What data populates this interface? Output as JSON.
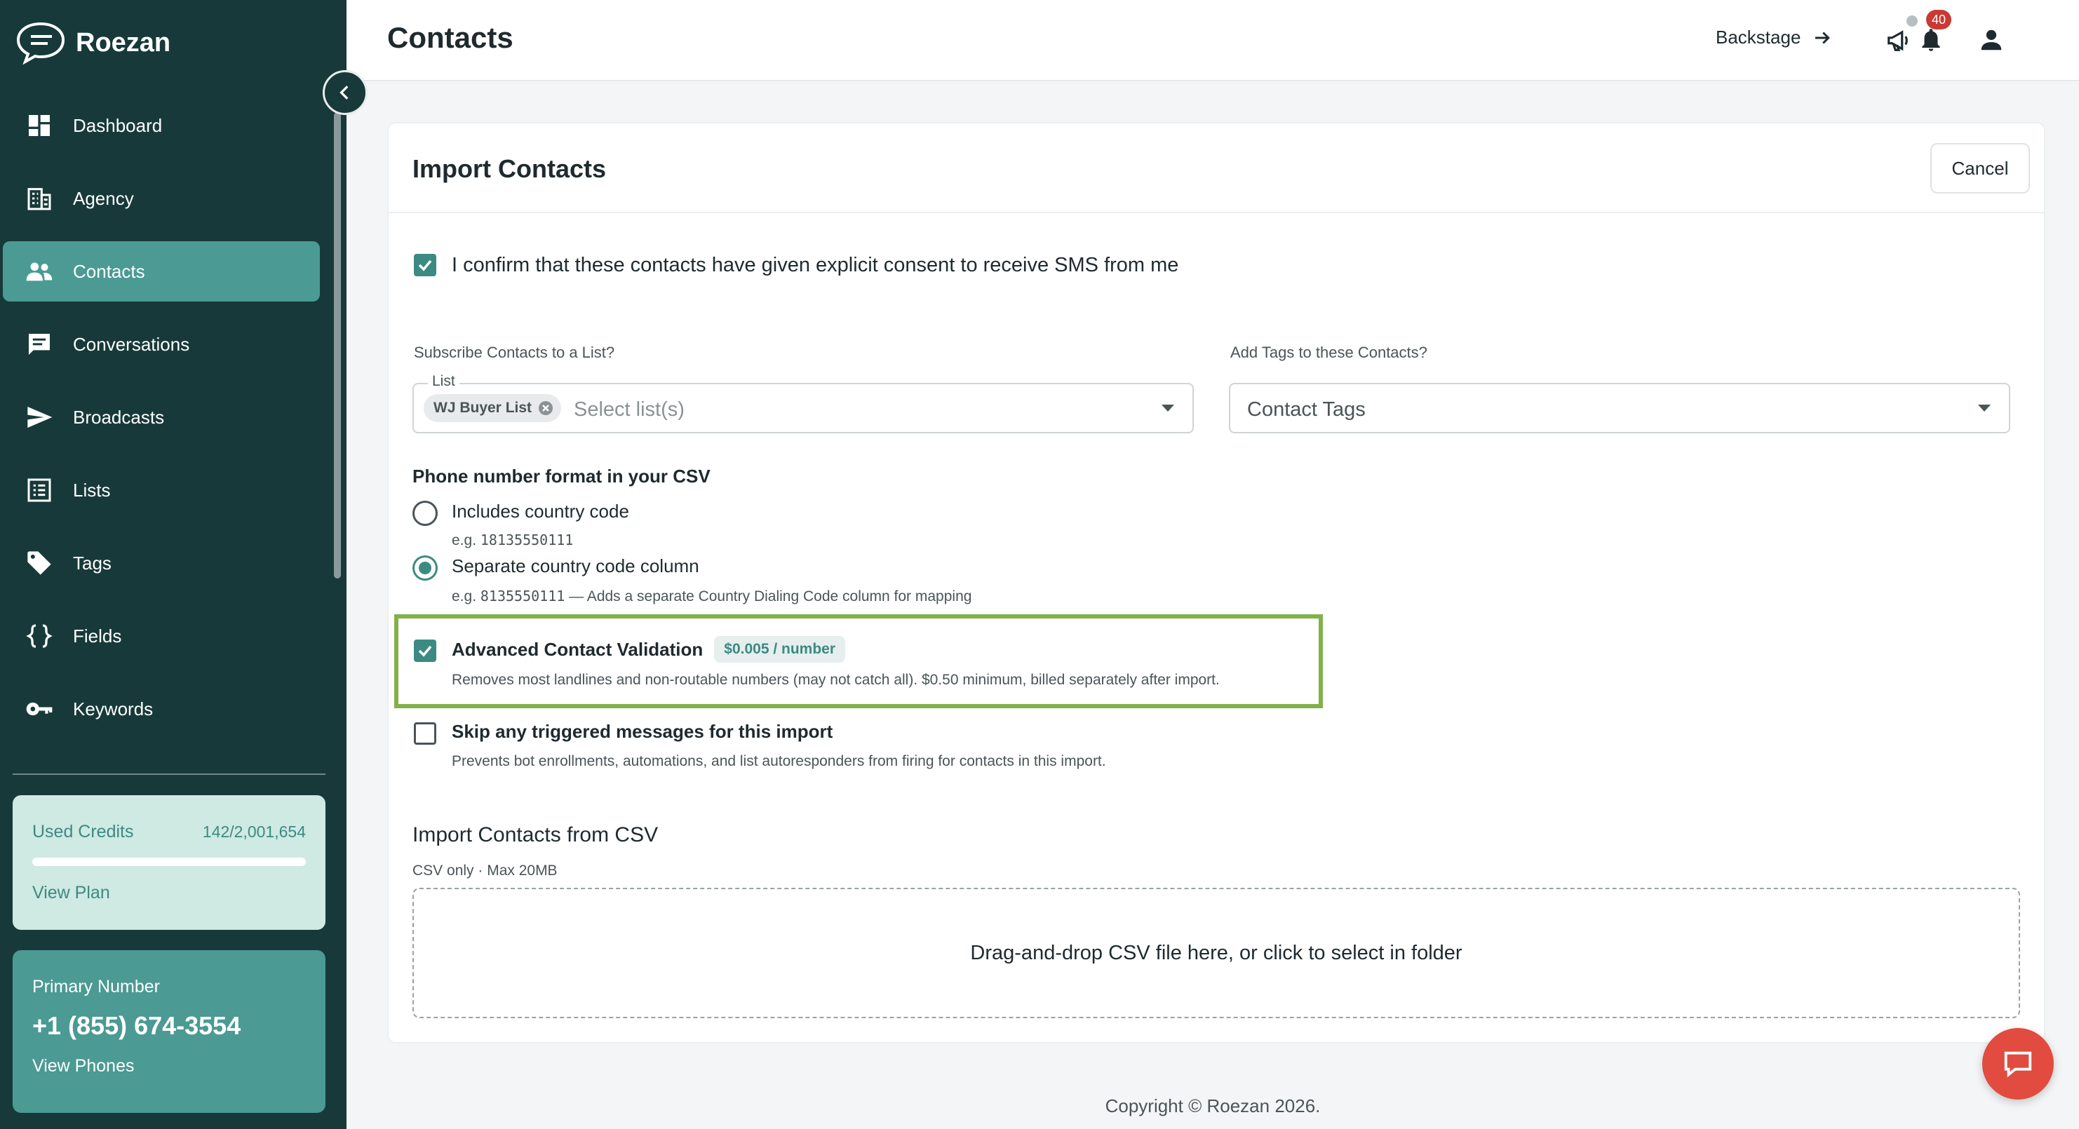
{
  "app": {
    "name": "Roezan"
  },
  "sidebar": {
    "items": [
      {
        "label": "Dashboard",
        "icon": "dashboard-icon"
      },
      {
        "label": "Agency",
        "icon": "building-icon"
      },
      {
        "label": "Contacts",
        "icon": "people-icon",
        "active": true
      },
      {
        "label": "Conversations",
        "icon": "chat-icon"
      },
      {
        "label": "Broadcasts",
        "icon": "send-icon"
      },
      {
        "label": "Lists",
        "icon": "list-icon"
      },
      {
        "label": "Tags",
        "icon": "tag-icon"
      },
      {
        "label": "Fields",
        "icon": "braces-icon"
      },
      {
        "label": "Keywords",
        "icon": "key-icon"
      }
    ],
    "credits": {
      "label": "Used Credits",
      "value": "142/2,001,654",
      "used_fraction": 7e-05,
      "link": "View Plan"
    },
    "primary_number": {
      "label": "Primary Number",
      "value": "+1 (855) 674-3554",
      "link": "View Phones"
    }
  },
  "header": {
    "title": "Contacts",
    "backstage_label": "Backstage",
    "notification_count": "40"
  },
  "import": {
    "title": "Import Contacts",
    "cancel_label": "Cancel",
    "consent": {
      "text": "I confirm that these contacts have given explicit consent to receive SMS from me",
      "checked": true
    },
    "subscribe": {
      "label": "Subscribe Contacts to a List?",
      "field_legend": "List",
      "chip": "WJ Buyer List",
      "placeholder": "Select list(s)"
    },
    "tags": {
      "label": "Add Tags to these Contacts?",
      "placeholder": "Contact Tags"
    },
    "phone_format": {
      "label": "Phone number format in your CSV",
      "options": [
        {
          "label": "Includes country code",
          "hint_prefix": "e.g.",
          "hint_example": "18135550111",
          "hint_suffix": "",
          "selected": false
        },
        {
          "label": "Separate country code column",
          "hint_prefix": "e.g.",
          "hint_example": "8135550111",
          "hint_suffix": " — Adds a separate Country Dialing Code column for mapping",
          "selected": true
        }
      ]
    },
    "validation": {
      "label": "Advanced Contact Validation",
      "price": "$0.005 / number",
      "description": "Removes most landlines and non-routable numbers (may not catch all). $0.50 minimum, billed separately after import.",
      "checked": true
    },
    "skip_triggers": {
      "label": "Skip any triggered messages for this import",
      "description": "Prevents bot enrollments, automations, and list autoresponders from firing for contacts in this import.",
      "checked": false
    },
    "csv": {
      "title": "Import Contacts from CSV",
      "subtitle": "CSV only · Max 20MB",
      "dropzone": "Drag-and-drop CSV file here, or click to select in folder"
    }
  },
  "footer": {
    "copyright": "Copyright © Roezan 2026."
  },
  "colors": {
    "sidebar_bg": "#17393a",
    "accent": "#3c8a82",
    "active_nav": "#4b9a94",
    "highlight_border": "#82b14a",
    "badge": "#c93a32",
    "chat_fab": "#e24b3f"
  }
}
